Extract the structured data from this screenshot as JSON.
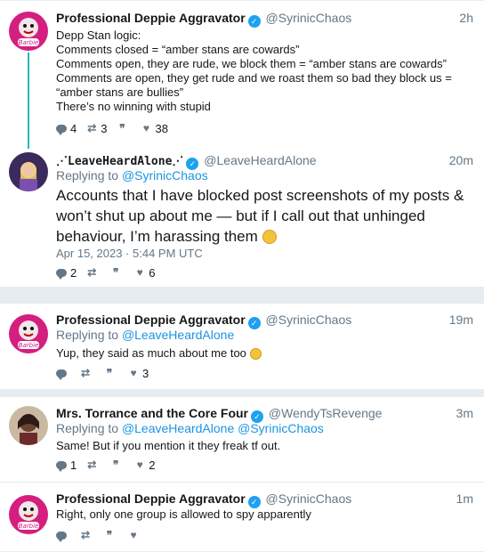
{
  "tweets": [
    {
      "name": "Professional Deppie Aggravator",
      "handle": "@SyrinicChaos",
      "time": "2h",
      "body_lines": [
        "Depp Stan logic:",
        "Comments closed = “amber stans are cowards”",
        "Comments open, they are rude, we block them = “amber stans are cowards”",
        "Comments are open, they get rude and we roast them so bad they block us =",
        "“amber stans are bullies”",
        "There’s no winning with stupid"
      ],
      "replies": "4",
      "retweets": "3",
      "likes": "38"
    },
    {
      "name": "LeaveHeardAlone",
      "handle": "@LeaveHeardAlone",
      "time": "20m",
      "replying_label": "Replying to",
      "replying_to": "@SyrinicChaos",
      "body": "Accounts that I have blocked post screenshots of my posts & won’t shut up about me — but if I call out that unhinged behaviour, I’m harassing them",
      "date": "Apr 15, 2023 · 5:44 PM UTC",
      "replies": "2",
      "likes": "6"
    },
    {
      "name": "Professional Deppie Aggravator",
      "handle": "@SyrinicChaos",
      "time": "19m",
      "replying_label": "Replying to",
      "replying_to": "@LeaveHeardAlone",
      "body": "Yup, they said as much about me too",
      "likes": "3"
    },
    {
      "name": "Mrs. Torrance and the Core Four",
      "handle": "@WendyTsRevenge",
      "time": "3m",
      "replying_label": "Replying to",
      "replying_to": "@LeaveHeardAlone @SyrinicChaos",
      "body": "Same! But if you mention it they freak tf out.",
      "replies": "1",
      "likes": "2"
    },
    {
      "name": "Professional Deppie Aggravator",
      "handle": "@SyrinicChaos",
      "time": "1m",
      "body": "Right, only one group is allowed to spy apparently"
    }
  ],
  "icons": {
    "verified": "verified-check-icon",
    "reply": "reply-bubble-icon",
    "retweet": "retweet-icon",
    "quote": "quote-icon",
    "like": "heart-icon"
  },
  "colors": {
    "accent": "#1da1f2",
    "link": "#1b95e0",
    "muted": "#657786",
    "thread": "#26b4c8"
  }
}
